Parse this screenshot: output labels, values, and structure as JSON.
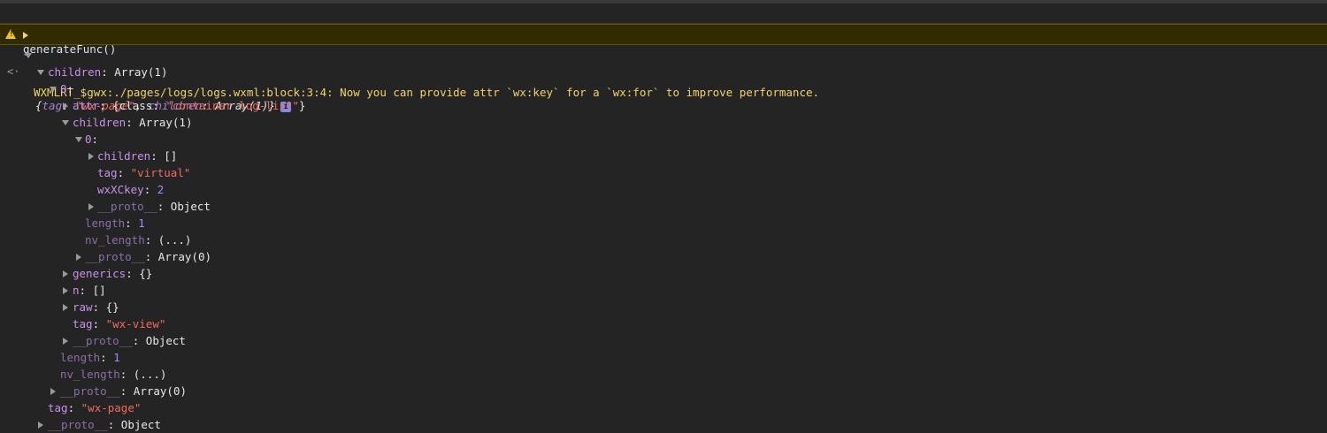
{
  "console": {
    "command": "generateFunc()",
    "warning": "WXMLRT_$gwx:./pages/logs/logs.wxml:block:3:4: Now you can provide attr `wx:key` for a `wx:for` to improve performance.",
    "summary": {
      "tag_key": "tag",
      "tag_val": "\"wx-page\"",
      "children_key": "children",
      "children_val": "Array(1)",
      "info": "i"
    },
    "tree": [
      {
        "key": "children",
        "sep": ": ",
        "val": "Array(1)"
      },
      {
        "key": "0",
        "sep": ":",
        "val": ""
      },
      {
        "key": "attr",
        "sep": ": ",
        "val_parts": [
          "{class: ",
          "\"container log-list\"",
          "}"
        ]
      },
      {
        "key": "children",
        "sep": ": ",
        "val": "Array(1)"
      },
      {
        "key": "0",
        "sep": ":",
        "val": ""
      },
      {
        "key": "children",
        "sep": ": ",
        "val": "[]"
      },
      {
        "key": "tag",
        "sep": ": ",
        "val": "\"virtual\""
      },
      {
        "key": "wxXCkey",
        "sep": ": ",
        "val": "2"
      },
      {
        "key": "__proto__",
        "sep": ": ",
        "val": "Object"
      },
      {
        "key": "length",
        "sep": ": ",
        "val": "1"
      },
      {
        "key": "nv_length",
        "sep": ": ",
        "val": "(...)"
      },
      {
        "key": "__proto__",
        "sep": ": ",
        "val": "Array(0)"
      },
      {
        "key": "generics",
        "sep": ": ",
        "val": "{}"
      },
      {
        "key": "n",
        "sep": ": ",
        "val": "[]"
      },
      {
        "key": "raw",
        "sep": ": ",
        "val": "{}"
      },
      {
        "key": "tag",
        "sep": ": ",
        "val": "\"wx-view\""
      },
      {
        "key": "__proto__",
        "sep": ": ",
        "val": "Object"
      },
      {
        "key": "length",
        "sep": ": ",
        "val": "1"
      },
      {
        "key": "nv_length",
        "sep": ": ",
        "val": "(...)"
      },
      {
        "key": "__proto__",
        "sep": ": ",
        "val": "Array(0)"
      },
      {
        "key": "tag",
        "sep": ": ",
        "val": "\"wx-page\""
      },
      {
        "key": "__proto__",
        "sep": ": ",
        "val": "Object"
      }
    ]
  },
  "colors": {
    "background": "#242424",
    "warning_bg": "#332b00",
    "warning_text": "#f2d26a",
    "key": "#c792ea",
    "string": "#ef6b5f",
    "number": "#9d8cff"
  },
  "icons": {
    "prompt": "chevron-right-icon",
    "warning": "warning-triangle-icon",
    "return": "return-arrow-icon",
    "expanded": "triangle-down-icon",
    "collapsed": "triangle-right-icon",
    "info": "info-icon"
  }
}
